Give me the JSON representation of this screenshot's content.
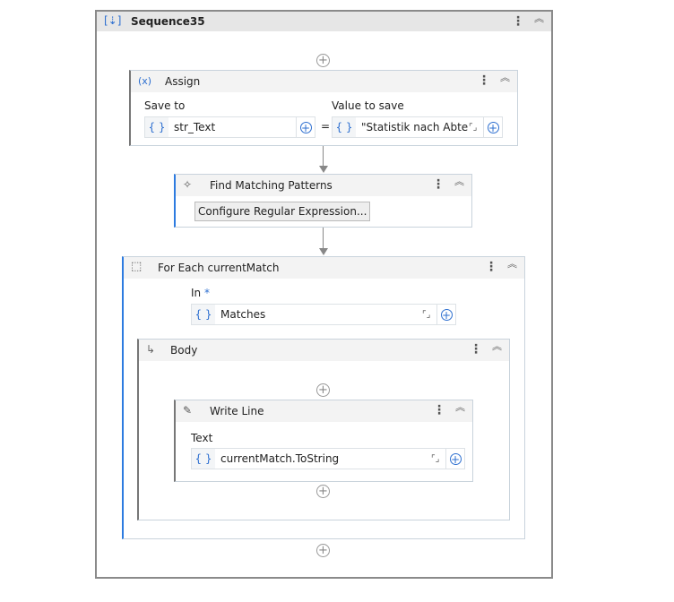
{
  "sequence": {
    "title": "Sequence35"
  },
  "assign": {
    "title": "Assign",
    "icon": "(x)",
    "save_to_label": "Save to",
    "save_to_value": "str_Text",
    "equals": "=",
    "value_label": "Value to save",
    "value": "\"Statistik nach Abteilur"
  },
  "find": {
    "title": "Find Matching Patterns",
    "button": "Configure Regular Expression..."
  },
  "foreach": {
    "title": "For Each currentMatch",
    "in_label": "In",
    "required": "*",
    "in_value": "Matches"
  },
  "body": {
    "title": "Body"
  },
  "writeline": {
    "title": "Write Line",
    "text_label": "Text",
    "text_value": "currentMatch.ToString"
  },
  "common": {
    "braces": "{ }",
    "plus": "+",
    "kebab": "⋮",
    "collapse": "︽"
  },
  "colors": {
    "accent": "#2d7be0"
  }
}
